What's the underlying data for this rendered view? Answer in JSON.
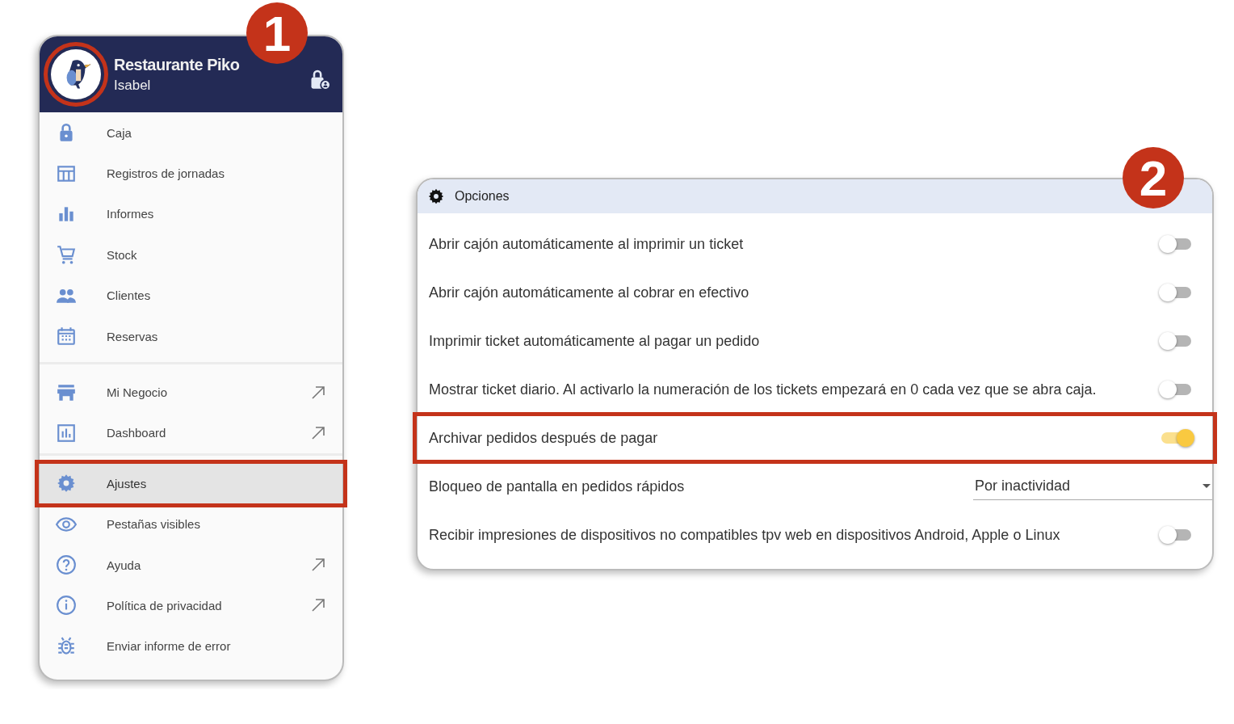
{
  "menu_panel": {
    "badge": "1",
    "header": {
      "title": "Restaurante Piko",
      "subtitle": "Isabel",
      "avatar_highlighted": true
    },
    "groups": [
      {
        "items": [
          {
            "label": "Caja",
            "external": false,
            "selected": false,
            "highlighted": false
          },
          {
            "label": "Registros de jornadas",
            "external": false,
            "selected": false,
            "highlighted": false
          },
          {
            "label": "Informes",
            "external": false,
            "selected": false,
            "highlighted": false
          },
          {
            "label": "Stock",
            "external": false,
            "selected": false,
            "highlighted": false
          },
          {
            "label": "Clientes",
            "external": false,
            "selected": false,
            "highlighted": false
          },
          {
            "label": "Reservas",
            "external": false,
            "selected": false,
            "highlighted": false
          }
        ]
      },
      {
        "items": [
          {
            "label": "Mi Negocio",
            "external": true,
            "selected": false,
            "highlighted": false
          },
          {
            "label": "Dashboard",
            "external": true,
            "selected": false,
            "highlighted": false
          }
        ]
      },
      {
        "items": [
          {
            "label": "Ajustes",
            "external": false,
            "selected": true,
            "highlighted": true
          },
          {
            "label": "Pestañas visibles",
            "external": false,
            "selected": false,
            "highlighted": false
          },
          {
            "label": "Ayuda",
            "external": true,
            "selected": false,
            "highlighted": false
          },
          {
            "label": "Política de privacidad",
            "external": true,
            "selected": false,
            "highlighted": false
          },
          {
            "label": "Enviar informe de error",
            "external": false,
            "selected": false,
            "highlighted": false
          }
        ]
      }
    ]
  },
  "options_panel": {
    "badge": "2",
    "title": "Opciones",
    "rows": [
      {
        "kind": "toggle",
        "label": "Abrir cajón automáticamente al imprimir un ticket",
        "on": false,
        "highlighted": false
      },
      {
        "kind": "toggle",
        "label": "Abrir cajón automáticamente al cobrar en efectivo",
        "on": false,
        "highlighted": false
      },
      {
        "kind": "toggle",
        "label": "Imprimir ticket automáticamente al pagar un pedido",
        "on": false,
        "highlighted": false
      },
      {
        "kind": "toggle",
        "label": "Mostrar ticket diario. Al activarlo la numeración de los tickets empezará en 0 cada vez que se abra caja.",
        "on": false,
        "highlighted": false
      },
      {
        "kind": "toggle",
        "label": "Archivar pedidos después de pagar",
        "on": true,
        "highlighted": true
      },
      {
        "kind": "select",
        "label": "Bloqueo de pantalla en pedidos rápidos",
        "value": "Por inactividad",
        "highlighted": false
      },
      {
        "kind": "toggle",
        "label": "Recibir impresiones de dispositivos no compatibles tpv web en dispositivos Android, Apple o Linux",
        "on": false,
        "highlighted": false
      }
    ]
  }
}
